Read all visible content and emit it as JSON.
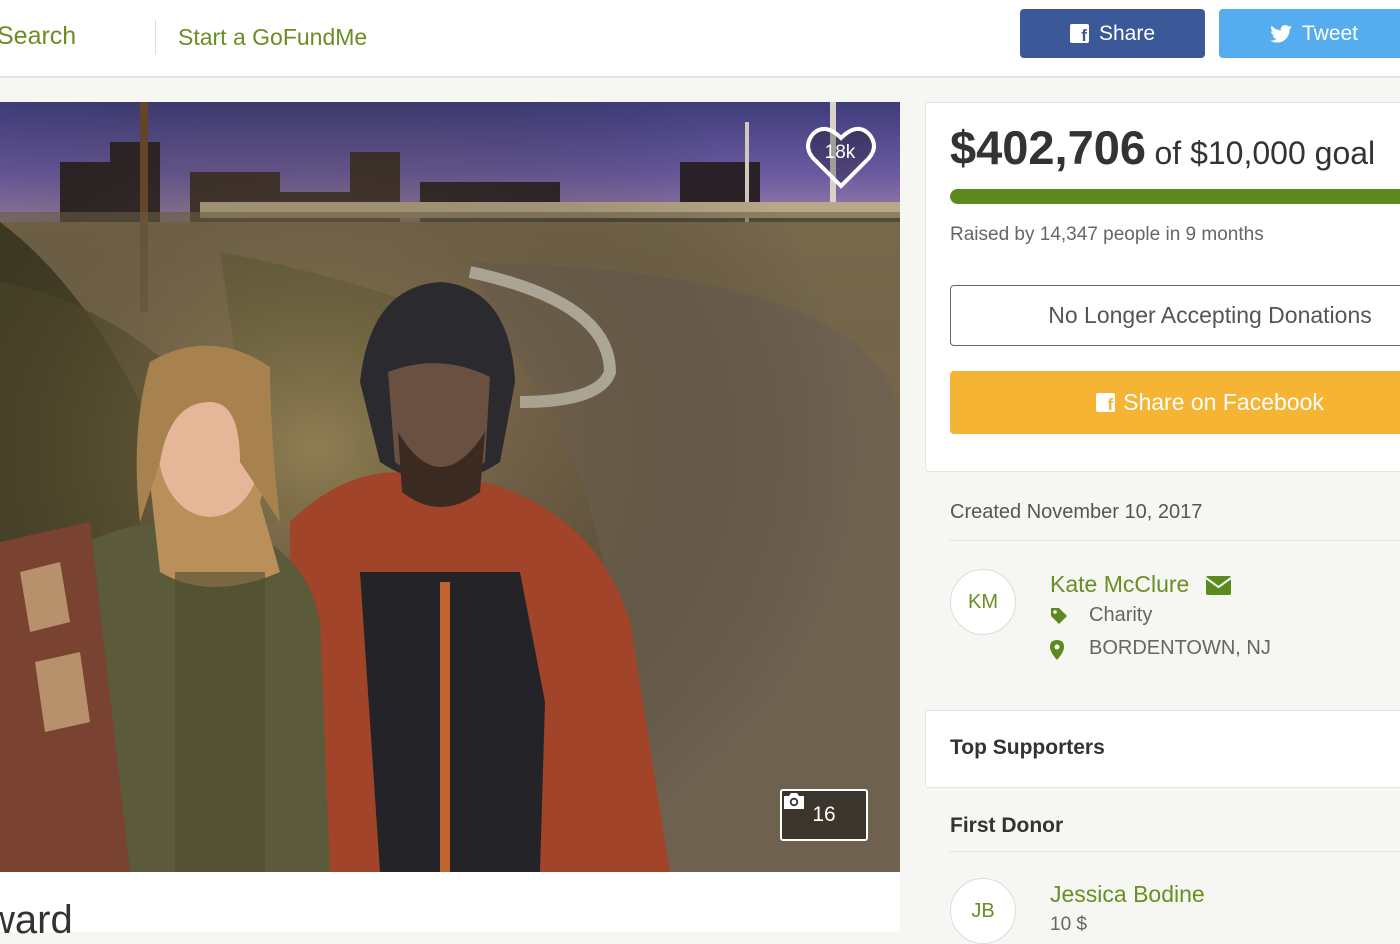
{
  "nav": {
    "search_label": "Search",
    "start_label": "Start a GoFundMe",
    "share_label": "Share",
    "tweet_label": "Tweet"
  },
  "photo": {
    "heart_count": "18k",
    "photo_count": "16"
  },
  "campaign": {
    "title_fragment": "ward"
  },
  "donation": {
    "raised": "$402,706",
    "goal_text": "of $10,000 goal",
    "progress_fraction": 1.0,
    "raised_by": "Raised by 14,347 people in 9 months",
    "no_longer_label": "No Longer Accepting Donations",
    "share_facebook_label": "Share on Facebook"
  },
  "organizer": {
    "created": "Created November 10, 2017",
    "initials": "KM",
    "name": "Kate McClure",
    "category": "Charity",
    "location": "BORDENTOWN, NJ"
  },
  "supporters": {
    "title": "Top Supporters",
    "first_donor_label": "First Donor",
    "donor_initials": "JB",
    "donor_name": "Jessica Bodine",
    "donor_amount": "10 $"
  },
  "colors": {
    "brand_green": "#6b8e23",
    "progress_green": "#5c8a1e",
    "facebook_blue": "#3b5998",
    "twitter_blue": "#55acee",
    "share_orange": "#f6b434"
  },
  "icons": [
    "facebook-icon",
    "twitter-icon",
    "heart-icon",
    "camera-icon",
    "mail-icon",
    "tag-icon",
    "map-pin-icon"
  ]
}
